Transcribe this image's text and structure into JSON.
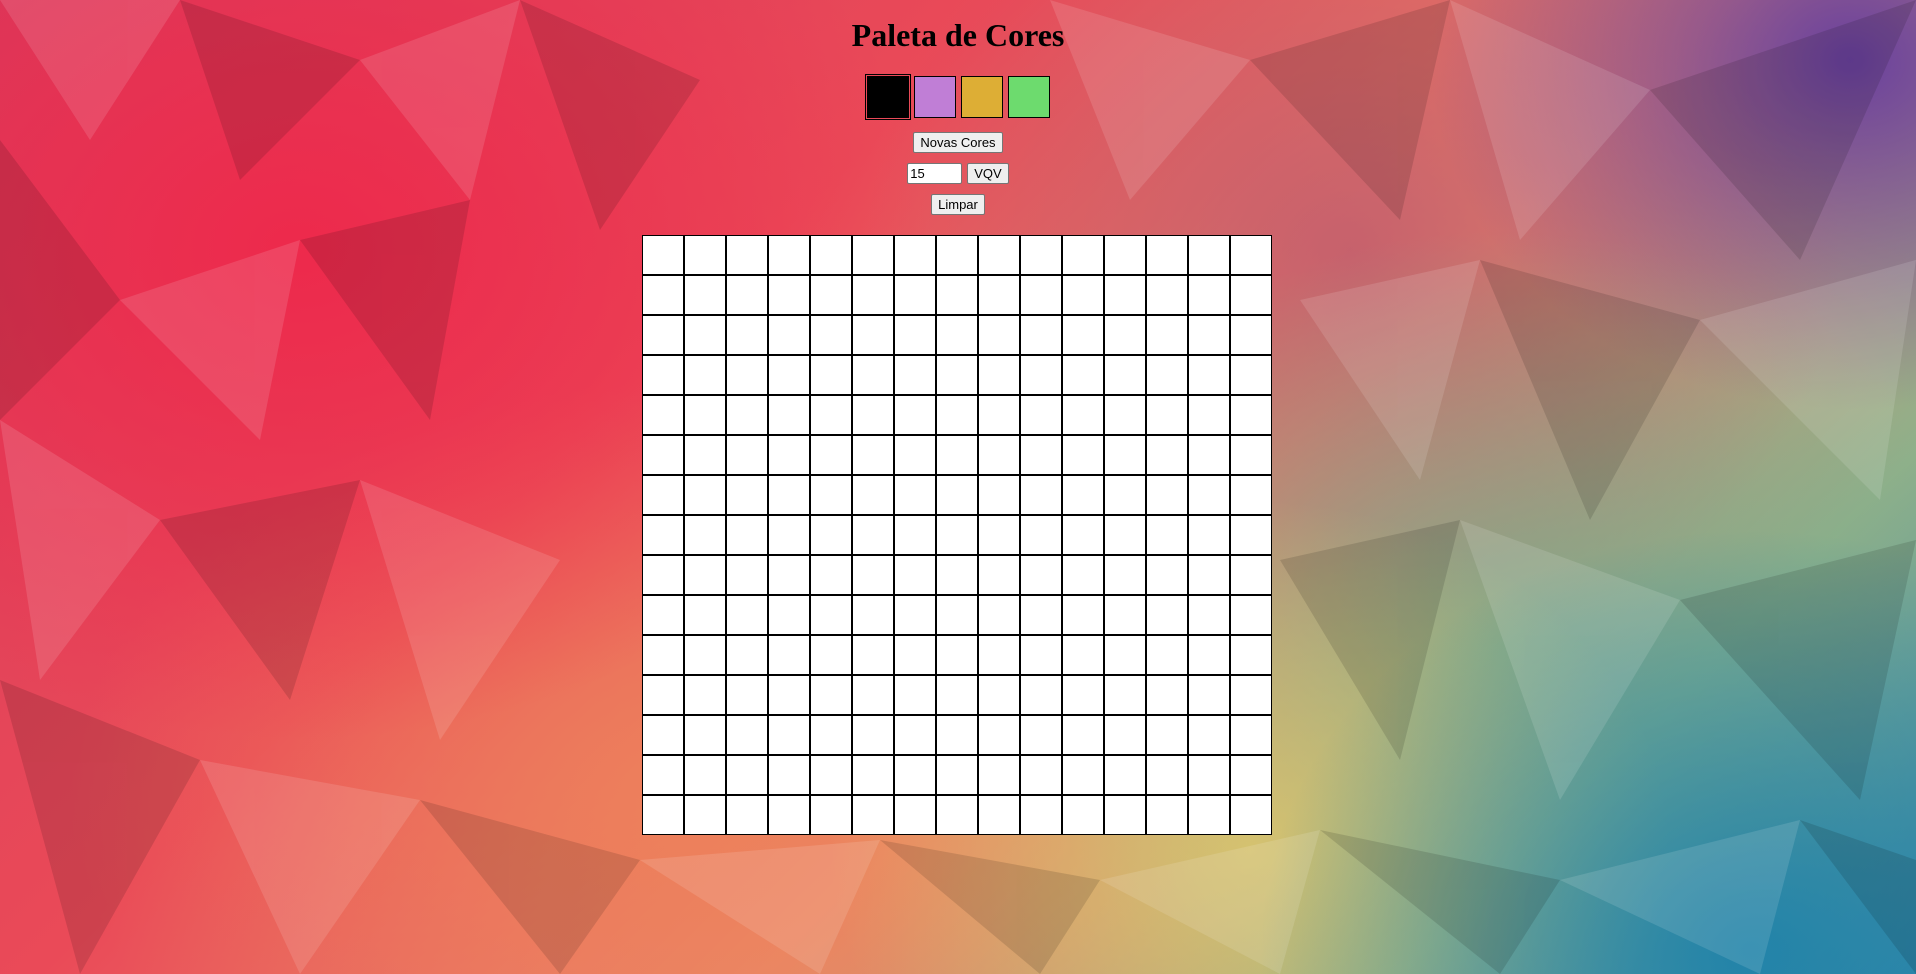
{
  "title": "Paleta de Cores",
  "palette": [
    {
      "color": "#000000",
      "selected": true
    },
    {
      "color": "#c07ed6",
      "selected": false
    },
    {
      "color": "#ddae35",
      "selected": false
    },
    {
      "color": "#6ddb6e",
      "selected": false
    }
  ],
  "buttons": {
    "random_colors": "Novas Cores",
    "generate_board": "VQV",
    "clear_board": "Limpar"
  },
  "board_size_input": {
    "value": "15"
  },
  "board": {
    "rows": 15,
    "columns": 15,
    "pixel_color": "#ffffff"
  }
}
